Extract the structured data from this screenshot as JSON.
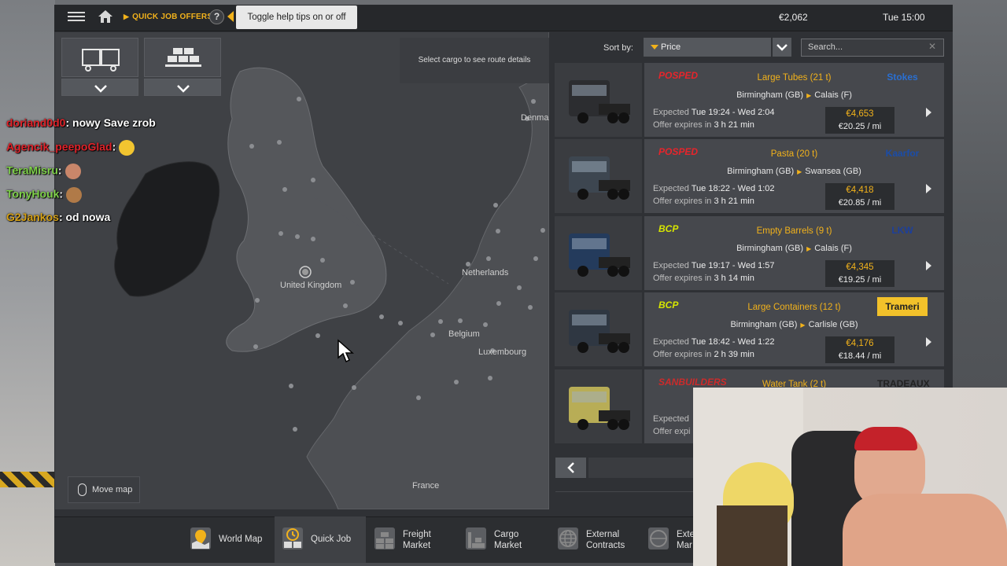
{
  "header": {
    "breadcrumb": "QUICK JOB OFFERS",
    "help_symbol": "?",
    "tooltip": "Toggle help tips on or off",
    "money": "€2,062",
    "time": "Tue 15:00"
  },
  "map": {
    "hint": "Select cargo to see route details",
    "labels": {
      "uk": "United Kingdom",
      "netherlands": "Netherlands",
      "belgium": "Belgium",
      "luxembourg": "Luxembourg",
      "france": "France",
      "denmark": "Denma"
    },
    "move_map": "Move map"
  },
  "sort": {
    "label": "Sort by:",
    "value": "Price",
    "search_placeholder": "Search..."
  },
  "offers": [
    {
      "company": "POSPED",
      "company_color": "#e8242b",
      "cargo": "Large Tubes (21 t)",
      "from": "Birmingham (GB)",
      "to": "Calais (F)",
      "expected_label": "Expected",
      "expected": "Tue 19:24 - Wed 2:04",
      "expires_label": "Offer expires in",
      "expires": "3 h 21 min",
      "price": "€4,653",
      "per_mile": "€20.25 / mi",
      "client": "Stokes",
      "client_color": "#2a6fd1"
    },
    {
      "company": "POSPED",
      "company_color": "#e8242b",
      "cargo": "Pasta (20 t)",
      "from": "Birmingham (GB)",
      "to": "Swansea (GB)",
      "expected_label": "Expected",
      "expected": "Tue 18:22 - Wed 1:02",
      "expires_label": "Offer expires in",
      "expires": "3 h 21 min",
      "price": "€4,418",
      "per_mile": "€20.85 / mi",
      "client": "Kaarfor",
      "client_color": "#1b4da8"
    },
    {
      "company": "BCP",
      "company_color": "#d7e600",
      "cargo": "Empty Barrels (9 t)",
      "from": "Birmingham (GB)",
      "to": "Calais (F)",
      "expected_label": "Expected",
      "expected": "Tue 19:17 - Wed 1:57",
      "expires_label": "Offer expires in",
      "expires": "3 h 14 min",
      "price": "€4,345",
      "per_mile": "€19.25 / mi",
      "client": "LKW",
      "client_color": "#1c3f9c"
    },
    {
      "company": "BCP",
      "company_color": "#d7e600",
      "cargo": "Large Containers (12 t)",
      "from": "Birmingham (GB)",
      "to": "Carlisle (GB)",
      "expected_label": "Expected",
      "expected": "Tue 18:42 - Wed 1:22",
      "expires_label": "Offer expires in",
      "expires": "2 h 39 min",
      "price": "€4,176",
      "per_mile": "€18.44 / mi",
      "client": "Trameri",
      "client_color": "#f2c12a"
    },
    {
      "company": "SANBUILDERS",
      "company_color": "#cc2b2b",
      "cargo": "Water Tank (2 t)",
      "from": "",
      "to": "",
      "expected_label": "Expected",
      "expected": "",
      "expires_label": "Offer expi",
      "expires": "",
      "price": "",
      "per_mile": "",
      "client": "TRADEAUX",
      "client_color": "#222222"
    }
  ],
  "nav": [
    {
      "label": "World Map"
    },
    {
      "label": "Quick Job"
    },
    {
      "label": "Freight\nMarket"
    },
    {
      "label": "Cargo\nMarket"
    },
    {
      "label": "External\nContracts"
    },
    {
      "label": "Exte\nMar"
    }
  ],
  "chat": [
    {
      "user": "doriand0d0",
      "color": "#e0232a",
      "text": ": nowy Save zrob"
    },
    {
      "user": "Agencik_peepoGlad",
      "color": "#e0232a",
      "text": ":"
    },
    {
      "user": "TeraMisru",
      "color": "#7fd14a",
      "text": ":"
    },
    {
      "user": "TonyHouk",
      "color": "#7fd14a",
      "text": ":"
    },
    {
      "user": "G2Jankos",
      "color": "#d4a017",
      "text": ": od nowa"
    }
  ]
}
